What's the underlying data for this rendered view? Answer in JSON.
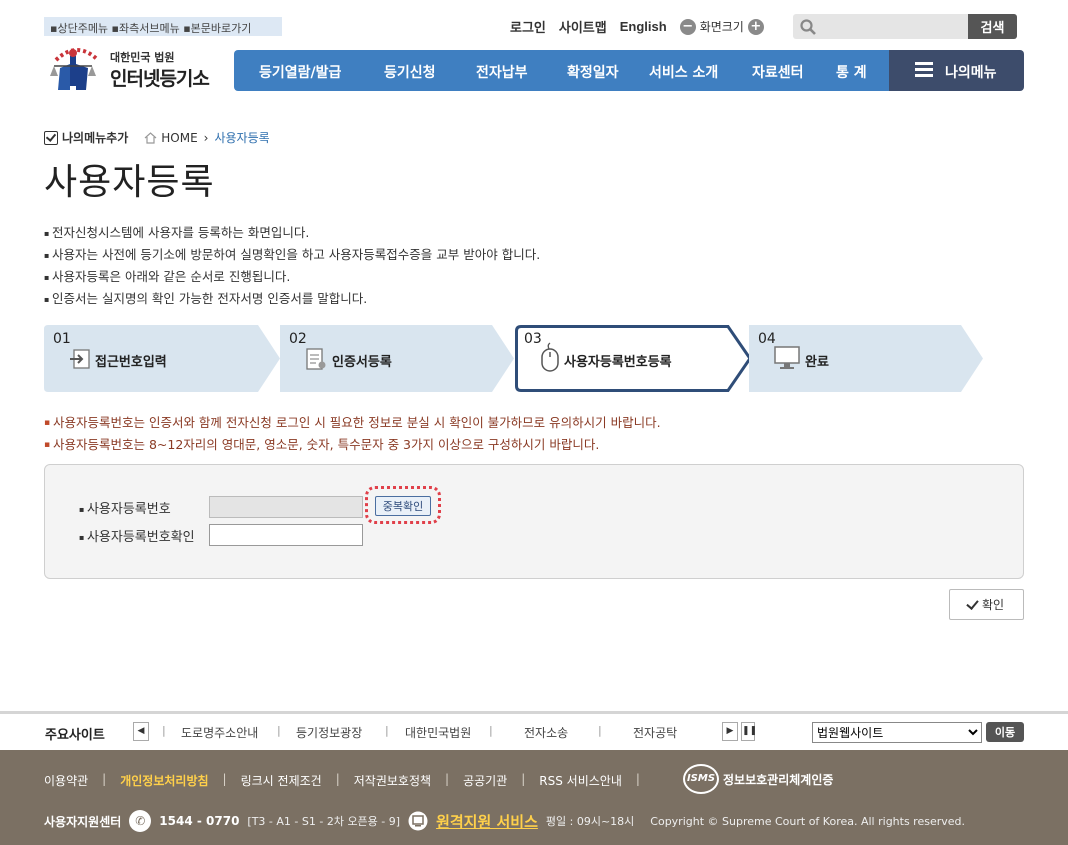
{
  "skip_links": "▪상단주메뉴 ▪좌측서브메뉴 ▪본문바로가기",
  "util": {
    "login": "로그인",
    "sitemap": "사이트맵",
    "english": "English",
    "font_size": "화면크기",
    "minus": "−",
    "plus": "+"
  },
  "search": {
    "placeholder": "",
    "button": "검색"
  },
  "logo": {
    "sub": "대한민국 법원",
    "main": "인터넷등기소"
  },
  "gnb": [
    "등기열람/발급",
    "등기신청",
    "전자납부",
    "확정일자",
    "서비스 소개",
    "자료센터",
    "통 계"
  ],
  "my_menu": "나의메뉴",
  "breadcrumb": {
    "add": "나의메뉴추가",
    "home": "HOME",
    "sep": "›",
    "current": "사용자등록"
  },
  "page_title": "사용자등록",
  "description": [
    "전자신청시스템에 사용자를 등록하는 화면입니다.",
    "사용자는 사전에 등기소에 방문하여 실명확인을 하고 사용자등록접수증을 교부 받아야 합니다.",
    "사용자등록은 아래와 같은 순서로 진행됩니다.",
    "인증서는 실지명의 확인 가능한 전자서명 인증서를 말합니다."
  ],
  "steps": [
    {
      "num": "01",
      "label": "접근번호입력",
      "icon": "enter-icon",
      "active": false
    },
    {
      "num": "02",
      "label": "인증서등록",
      "icon": "certificate-icon",
      "active": false
    },
    {
      "num": "03",
      "label": "사용자등록번호등록",
      "icon": "mouse-icon",
      "active": true
    },
    {
      "num": "04",
      "label": "완료",
      "icon": "monitor-icon",
      "active": false
    }
  ],
  "warnings": [
    "사용자등록번호는 인증서와 함께 전자신청 로그인 시 필요한 정보로 분실 시 확인이 불가하므로 유의하시기 바랍니다.",
    "사용자등록번호는 8~12자리의 영대문, 영소문, 숫자, 특수문자 중 3가지 이상으로 구성하시기 바랍니다."
  ],
  "form": {
    "reg_no_label": "사용자등록번호",
    "reg_no_value": "",
    "dup_check": "중복확인",
    "confirm_label": "사용자등록번호확인",
    "confirm_value": ""
  },
  "confirm_button": "확인",
  "footer": {
    "major_sites": "주요사이트",
    "site_links": [
      "도로명주소안내",
      "등기정보광장",
      "대한민국법원",
      "전자소송",
      "전자공탁"
    ],
    "site_select": "법원웹사이트",
    "go": "이동",
    "links": [
      "이용약관",
      "개인정보처리방침",
      "링크시 전제조건",
      "저작권보호정책",
      "공공기관",
      "RSS 서비스안내"
    ],
    "isms_badge": "ISMS",
    "isms": "정보보호관리체계인증",
    "support": "사용자지원센터",
    "phone": "1544 - 0770",
    "phone_detail": "[T3 - A1 - S1 - 2차 오픈용 - 9]",
    "remote": "원격지원 서비스",
    "hours": "평일 : 09시~18시",
    "copyright": "Copyright © Supreme Court of Korea. All rights reserved."
  },
  "colors": {
    "nav_blue": "#3f7fc1",
    "my_menu_navy": "#3d4c6b",
    "footer_brown": "#7b7063",
    "warning_text": "#8a3a24",
    "highlight_yellow": "#ffd04a"
  }
}
